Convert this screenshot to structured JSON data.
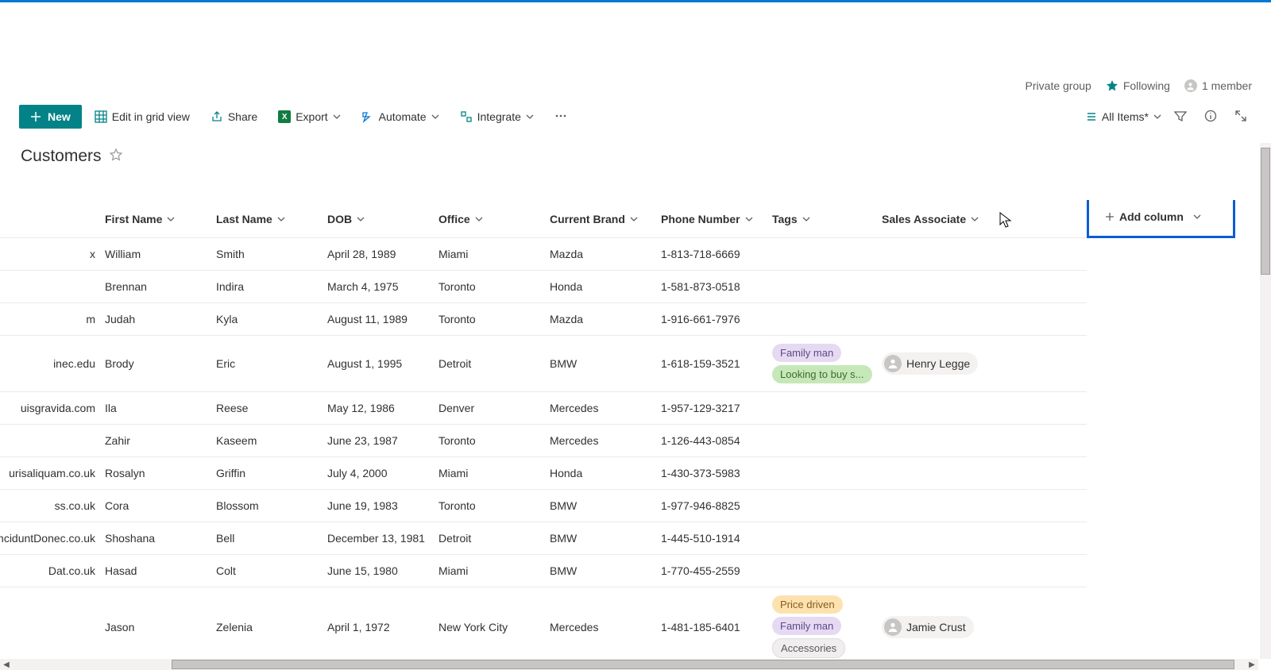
{
  "header": {
    "privateGroup": "Private group",
    "following": "Following",
    "members": "1 member"
  },
  "toolbar": {
    "new": "New",
    "editGrid": "Edit in grid view",
    "share": "Share",
    "export": "Export",
    "automate": "Automate",
    "integrate": "Integrate",
    "allItems": "All Items*"
  },
  "list": {
    "title": "Customers",
    "addColumn": "Add column",
    "columns": {
      "firstName": "First Name",
      "lastName": "Last Name",
      "dob": "DOB",
      "office": "Office",
      "currentBrand": "Current Brand",
      "phone": "Phone Number",
      "tags": "Tags",
      "salesAssoc": "Sales Associate"
    },
    "rows": [
      {
        "email": "x",
        "first": "William",
        "last": "Smith",
        "dob": "April 28, 1989",
        "office": "Miami",
        "brand": "Mazda",
        "phone": "1-813-718-6669",
        "tags": [],
        "assoc": null
      },
      {
        "email": "",
        "first": "Brennan",
        "last": "Indira",
        "dob": "March 4, 1975",
        "office": "Toronto",
        "brand": "Honda",
        "phone": "1-581-873-0518",
        "tags": [],
        "assoc": null
      },
      {
        "email": "m",
        "first": "Judah",
        "last": "Kyla",
        "dob": "August 11, 1989",
        "office": "Toronto",
        "brand": "Mazda",
        "phone": "1-916-661-7976",
        "tags": [],
        "assoc": null
      },
      {
        "email": "inec.edu",
        "first": "Brody",
        "last": "Eric",
        "dob": "August 1, 1995",
        "office": "Detroit",
        "brand": "BMW",
        "phone": "1-618-159-3521",
        "tags": [
          {
            "t": "Family man",
            "c": "purple"
          },
          {
            "t": "Looking to buy s...",
            "c": "green"
          }
        ],
        "assoc": "Henry Legge"
      },
      {
        "email": "uisgravida.com",
        "first": "Ila",
        "last": "Reese",
        "dob": "May 12, 1986",
        "office": "Denver",
        "brand": "Mercedes",
        "phone": "1-957-129-3217",
        "tags": [],
        "assoc": null
      },
      {
        "email": "",
        "first": "Zahir",
        "last": "Kaseem",
        "dob": "June 23, 1987",
        "office": "Toronto",
        "brand": "Mercedes",
        "phone": "1-126-443-0854",
        "tags": [],
        "assoc": null
      },
      {
        "email": "urisaliquam.co.uk",
        "first": "Rosalyn",
        "last": "Griffin",
        "dob": "July 4, 2000",
        "office": "Miami",
        "brand": "Honda",
        "phone": "1-430-373-5983",
        "tags": [],
        "assoc": null
      },
      {
        "email": "ss.co.uk",
        "first": "Cora",
        "last": "Blossom",
        "dob": "June 19, 1983",
        "office": "Toronto",
        "brand": "BMW",
        "phone": "1-977-946-8825",
        "tags": [],
        "assoc": null
      },
      {
        "email": "tinciduntDonec.co.uk",
        "first": "Shoshana",
        "last": "Bell",
        "dob": "December 13, 1981",
        "office": "Detroit",
        "brand": "BMW",
        "phone": "1-445-510-1914",
        "tags": [],
        "assoc": null
      },
      {
        "email": "Dat.co.uk",
        "first": "Hasad",
        "last": "Colt",
        "dob": "June 15, 1980",
        "office": "Miami",
        "brand": "BMW",
        "phone": "1-770-455-2559",
        "tags": [],
        "assoc": null
      },
      {
        "email": "",
        "first": "Jason",
        "last": "Zelenia",
        "dob": "April 1, 1972",
        "office": "New York City",
        "brand": "Mercedes",
        "phone": "1-481-185-6401",
        "tags": [
          {
            "t": "Price driven",
            "c": "orange"
          },
          {
            "t": "Family man",
            "c": "purple"
          },
          {
            "t": "Accessories",
            "c": "gray"
          }
        ],
        "assoc": "Jamie Crust"
      }
    ]
  }
}
